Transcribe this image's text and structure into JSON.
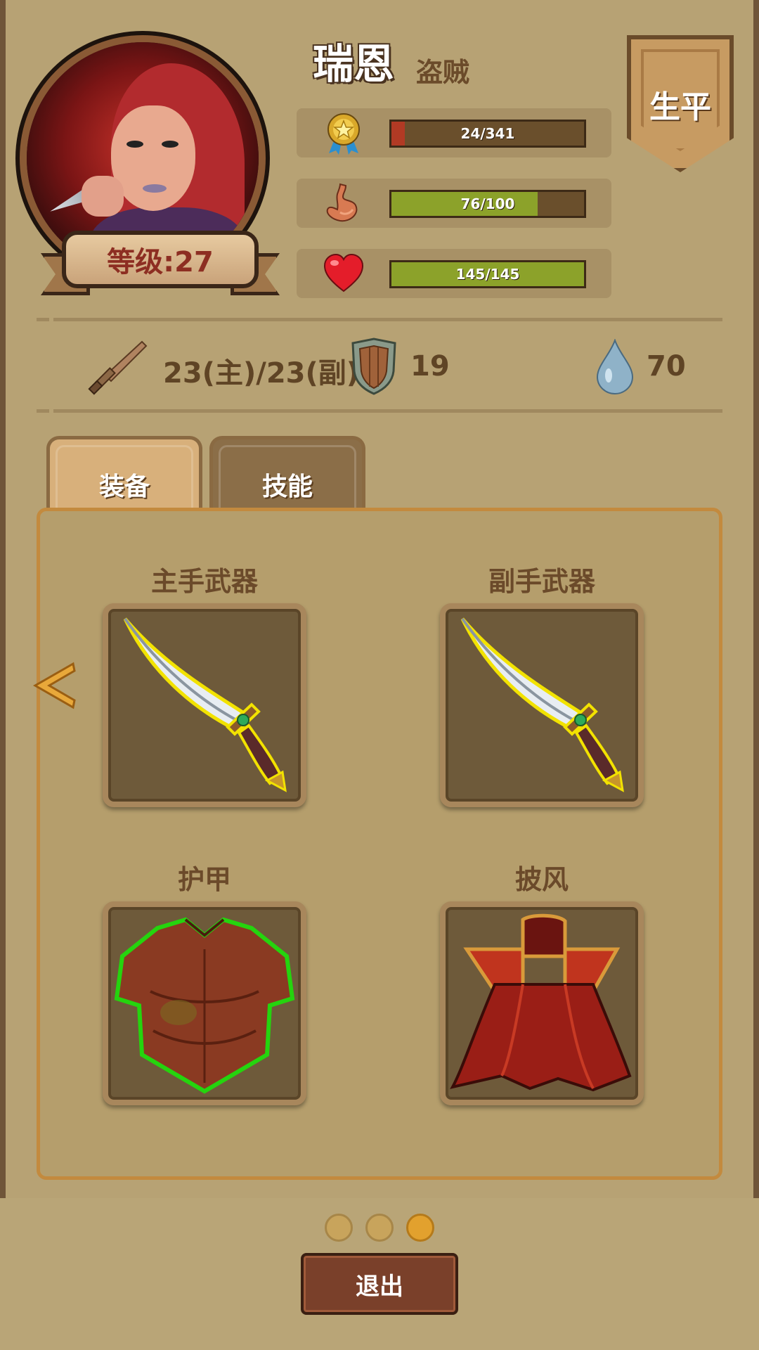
{
  "character": {
    "name": "瑞恩",
    "class": "盗贼",
    "level_label": "等级:27"
  },
  "biography_button": "生平",
  "stats": [
    {
      "icon": "medal-icon",
      "text": "24/341",
      "value": 24,
      "max": 341,
      "fill_color": "#b13a24"
    },
    {
      "icon": "stomach-icon",
      "text": "76/100",
      "value": 76,
      "max": 100,
      "fill_color": "#8ca22a"
    },
    {
      "icon": "heart-icon",
      "text": "145/145",
      "value": 145,
      "max": 145,
      "fill_color": "#8ca22a"
    }
  ],
  "attributes": {
    "attack": "23(主)/23(副)",
    "defense": "19",
    "dodge": "70"
  },
  "tabs": [
    {
      "label": "装备",
      "active": true
    },
    {
      "label": "技能",
      "active": false
    }
  ],
  "equipment": {
    "main_hand": {
      "label": "主手武器",
      "item_icon": "dagger-icon"
    },
    "off_hand": {
      "label": "副手武器",
      "item_icon": "dagger-icon"
    },
    "armor": {
      "label": "护甲",
      "item_icon": "leather-armor-icon"
    },
    "cloak": {
      "label": "披风",
      "item_icon": "red-cloak-icon"
    }
  },
  "pager": {
    "count": 3,
    "active_index": 2
  },
  "exit_button": "退出"
}
